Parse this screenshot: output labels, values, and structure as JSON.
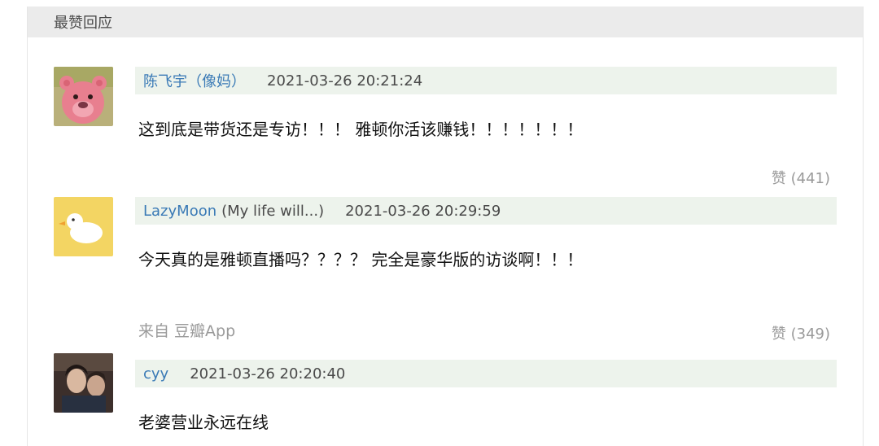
{
  "section_title": "最赞回应",
  "comments": [
    {
      "avatar_icon": "pink-bear-avatar-icon",
      "author": "陈飞宇（像妈）",
      "signature": "",
      "time": "2021-03-26 20:21:24",
      "text": "这到底是带货还是专访！！！ 雅顿你活该赚钱！！！！！！！",
      "source": "",
      "likes": "赞 (441)"
    },
    {
      "avatar_icon": "white-duck-avatar-icon",
      "author": "LazyMoon",
      "signature": "(My life will...)",
      "time": "2021-03-26 20:29:59",
      "text": "今天真的是雅顿直播吗？？？？ 完全是豪华版的访谈啊！！！",
      "source": "来自 豆瓣App",
      "likes": "赞 (349)"
    },
    {
      "avatar_icon": "people-photo-avatar-icon",
      "author": "cyy",
      "signature": "",
      "time": "2021-03-26 20:20:40",
      "text": "老婆营业永远在线",
      "source": "",
      "likes": ""
    }
  ]
}
